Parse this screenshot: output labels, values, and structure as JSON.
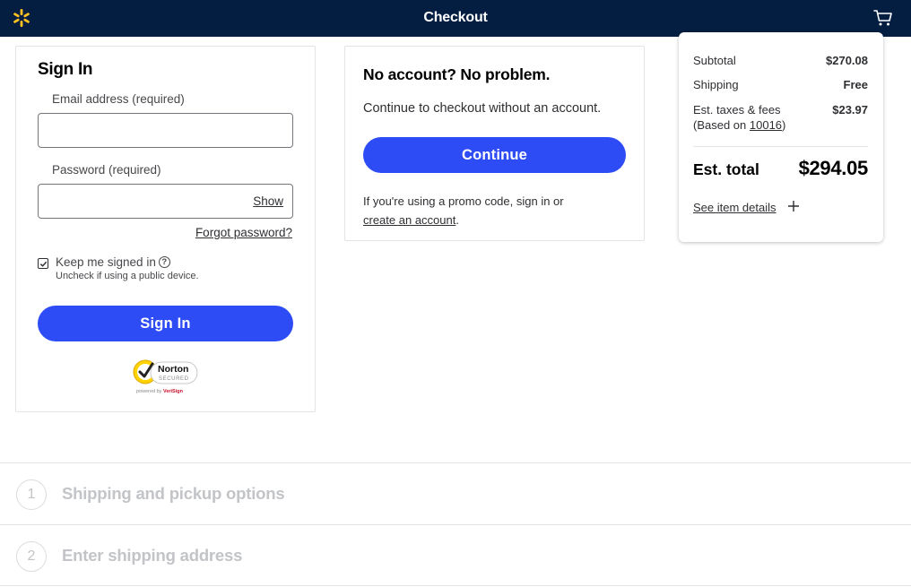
{
  "header": {
    "title": "Checkout",
    "logo_icon": "walmart-spark-icon",
    "cart_icon": "cart-icon",
    "background": "#041e42",
    "logo_color": "#ffc220"
  },
  "signin": {
    "title": "Sign In",
    "email_label": "Email address (required)",
    "email_value": "",
    "password_label": "Password (required)",
    "password_value": "",
    "show_label": "Show",
    "forgot_label": "Forgot password?",
    "keep_signed_in": "Keep me signed in",
    "keep_checked": true,
    "uncheck_hint": "Uncheck if using a public device.",
    "button": "Sign In",
    "norton": {
      "brand": "Norton",
      "secured": "SECURED",
      "powered": "powered by VeriSign"
    }
  },
  "guest": {
    "title": "No account? No problem.",
    "subtitle": "Continue to checkout without an account.",
    "button": "Continue",
    "promo_text": "If you're using a promo code, sign in or",
    "promo_link": "create an account",
    "promo_end": "."
  },
  "summary": {
    "subtotal_label": "Subtotal",
    "subtotal_value": "$270.08",
    "shipping_label": "Shipping",
    "shipping_value": "Free",
    "taxes_label": "Est. taxes & fees",
    "taxes_based_prefix": "(Based on",
    "taxes_zip": "10016",
    "taxes_based_suffix": ")",
    "taxes_value": "$23.97",
    "total_label": "Est. total",
    "total_value": "$294.05",
    "see_details": "See item details"
  },
  "steps": [
    {
      "number": "1",
      "title": "Shipping and pickup options"
    },
    {
      "number": "2",
      "title": "Enter shipping address"
    }
  ],
  "colors": {
    "primary_button": "#2d4cf6",
    "text": "#2e2f32",
    "disabled": "#c2c4c7"
  }
}
